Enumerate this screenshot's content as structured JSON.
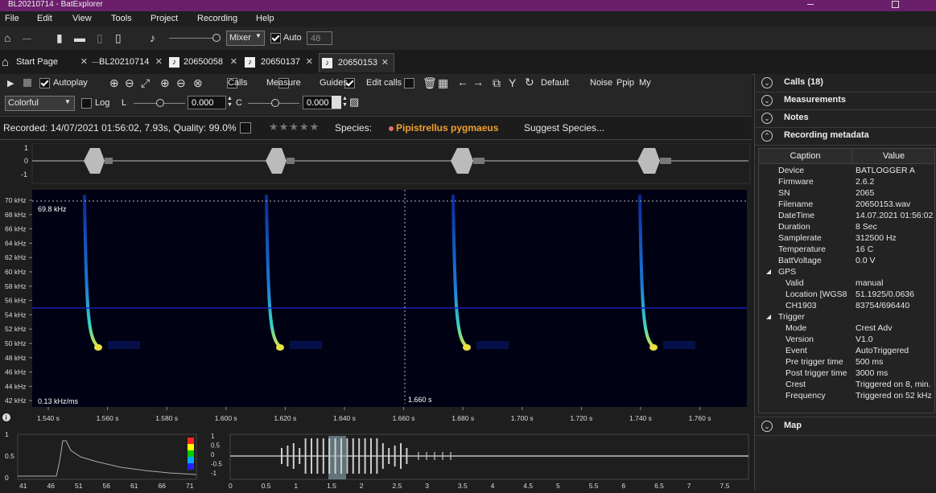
{
  "window": {
    "title": "BL20210714 - BatExplorer"
  },
  "menu": [
    "File",
    "Edit",
    "View",
    "Tools",
    "Project",
    "Recording",
    "Help"
  ],
  "toolbar": {
    "mixer_label": "Mixer",
    "auto_label": "Auto",
    "auto_value": "48"
  },
  "tabs": [
    {
      "label": "Start Page",
      "icon": "home-icon"
    },
    {
      "label": "BL20210714",
      "icon": "bat-icon"
    },
    {
      "label": "20650058",
      "icon": "music-note-icon"
    },
    {
      "label": "20650137",
      "icon": "music-note-icon"
    },
    {
      "label": "20650153",
      "icon": "music-note-icon",
      "active": true
    }
  ],
  "view_toolbar": {
    "autoplay": "Autoplay",
    "calls": "Calls",
    "measure": "Measure",
    "guides": "Guides",
    "edit_calls": "Edit calls",
    "default": "Default",
    "noise": "Noise",
    "ppip": "Ppip",
    "my": "My"
  },
  "color_toolbar": {
    "palette": "Colorful",
    "log": "Log",
    "l_label": "L",
    "l_value": "0.000",
    "c_label": "C",
    "c_value": "0.000"
  },
  "info": {
    "recorded": "Recorded: 14/07/2021 01:56:02, 7.93s, Quality: 99.0%",
    "species_label": "Species:",
    "species": "Pipistrellus pygmaeus",
    "suggest": "Suggest Species...",
    "species_color": "#f0a030"
  },
  "waveform": {
    "y_ticks": [
      "1",
      "0",
      "-1"
    ]
  },
  "spectrogram": {
    "y_labels": [
      "70 kHz",
      "68 kHz",
      "66 kHz",
      "64 kHz",
      "62 kHz",
      "60 kHz",
      "58 kHz",
      "56 kHz",
      "54 kHz",
      "52 kHz",
      "50 kHz",
      "48 kHz",
      "46 kHz",
      "44 kHz",
      "42 kHz"
    ],
    "x_labels": [
      "1.540 s",
      "1.560 s",
      "1.580 s",
      "1.600 s",
      "1.620 s",
      "1.640 s",
      "1.660 s",
      "1.680 s",
      "1.700 s",
      "1.720 s",
      "1.740 s",
      "1.760 s"
    ],
    "top_freq": "69.8 kHz",
    "slope": "0.13 kHz/ms",
    "cursor_time": "1.660 s"
  },
  "spectrum": {
    "y_labels": [
      "1",
      "0.5",
      "0"
    ],
    "x_labels": [
      "41",
      "46",
      "51",
      "56",
      "61",
      "66",
      "71"
    ]
  },
  "overview": {
    "y_labels": [
      "1",
      "0.5",
      "0",
      "-0.5",
      "-1"
    ],
    "x_labels": [
      "0",
      "0.5",
      "1",
      "1.5",
      "2",
      "2.5",
      "3",
      "3.5",
      "4",
      "4.5",
      "5",
      "5.5",
      "6",
      "6.5",
      "7",
      "7.5"
    ]
  },
  "panels": {
    "calls": "Calls (18)",
    "measurements": "Measurements",
    "notes": "Notes",
    "metadata": "Recording metadata",
    "map": "Map",
    "caption_header": "Caption",
    "value_header": "Value"
  },
  "metadata": [
    {
      "k": "Device",
      "v": "BATLOGGER A",
      "indent": 1
    },
    {
      "k": "Firmware",
      "v": "2.6.2",
      "indent": 1
    },
    {
      "k": "SN",
      "v": "2065",
      "indent": 1
    },
    {
      "k": "Filename",
      "v": "20650153.wav",
      "indent": 1
    },
    {
      "k": "DateTime",
      "v": "14.07.2021 01:56:02",
      "indent": 1
    },
    {
      "k": "Duration",
      "v": "8 Sec",
      "indent": 1
    },
    {
      "k": "Samplerate",
      "v": "312500 Hz",
      "indent": 1
    },
    {
      "k": "Temperature",
      "v": "16 C",
      "indent": 1
    },
    {
      "k": "BattVoltage",
      "v": "0.0 V",
      "indent": 1
    },
    {
      "k": "GPS",
      "v": "",
      "indent": 0,
      "group": true
    },
    {
      "k": "Valid",
      "v": "manual",
      "indent": 2
    },
    {
      "k": "Location [WGS8",
      "v": "51.1925/0.0636",
      "indent": 2
    },
    {
      "k": "CH1903",
      "v": "83754/696440",
      "indent": 2
    },
    {
      "k": "Trigger",
      "v": "",
      "indent": 0,
      "group": true
    },
    {
      "k": "Mode",
      "v": "Crest Adv",
      "indent": 2
    },
    {
      "k": "Version",
      "v": "V1.0",
      "indent": 2
    },
    {
      "k": "Event",
      "v": "AutoTriggered",
      "indent": 2
    },
    {
      "k": "Pre trigger time",
      "v": "500 ms",
      "indent": 2
    },
    {
      "k": "Post trigger time",
      "v": "3000 ms",
      "indent": 2
    },
    {
      "k": "Crest",
      "v": "Triggered on 8, min.",
      "indent": 2
    },
    {
      "k": "Frequency",
      "v": "Triggered on 52 kHz",
      "indent": 2
    }
  ]
}
